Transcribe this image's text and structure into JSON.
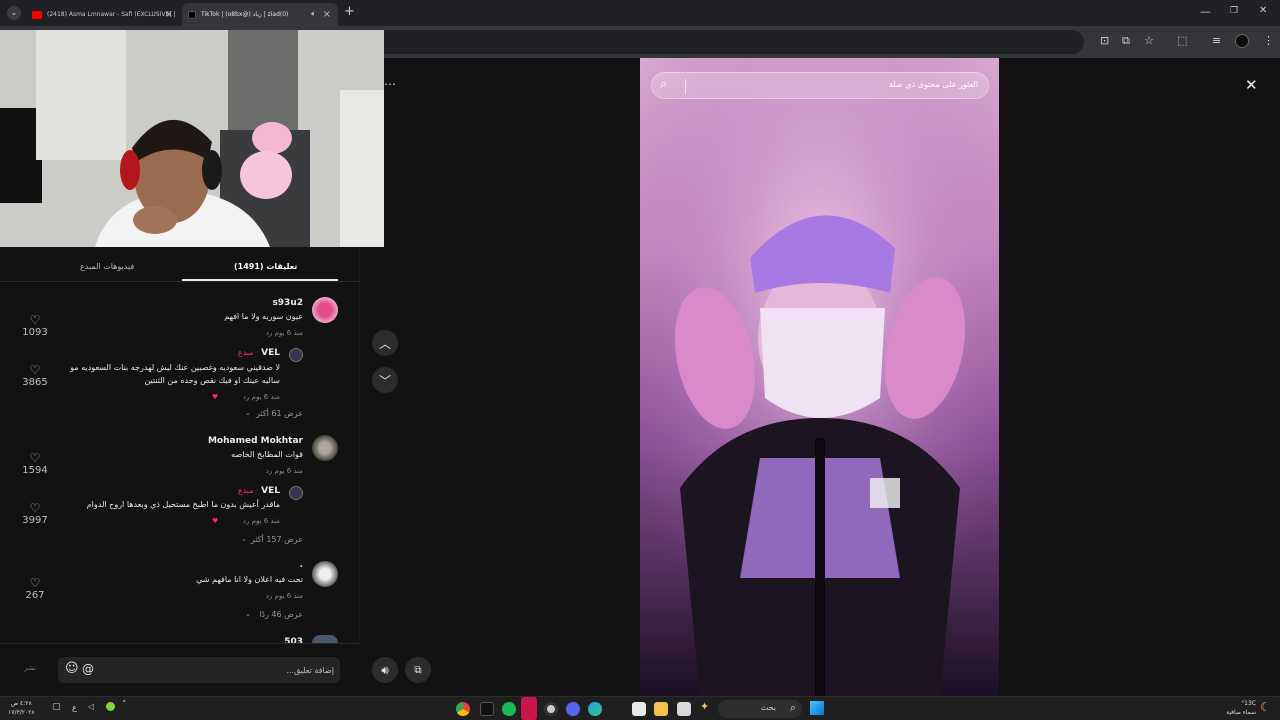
{
  "browser": {
    "tabs": [
      {
        "label": "(2418) Asma Lmnawar - Safi (EXCLUSIVE) |",
        "favicon": "youtube-icon"
      },
      {
        "label": "TikTok | (o8bx@) زياد | ziad(0)",
        "favicon": "tiktok-icon"
      }
    ],
    "new_tab": "+",
    "window_controls": [
      "—",
      "❐",
      "✕"
    ]
  },
  "comments_panel": {
    "tabs": {
      "creator_videos": "فيديوهات المبدع",
      "comments": "(1491) تعليقات"
    },
    "comments": [
      {
        "user": "s93u2",
        "text": "عيون سوريه ولا ما افهم",
        "meta": "منذ 6 يوم   رد",
        "likes": "1093",
        "reply": {
          "user": "VEL",
          "badge": "· مبدع",
          "text": "لا صدقيني سعوديه وغصبين عنك ليش لهدرجه بنات السعوديه مو ساليه عينك او فيك نقص وحده من الثنتين",
          "meta": "منذ 6 يوم   رد",
          "likes": "3865"
        },
        "more": "عرض 61 أكثر"
      },
      {
        "user": "Mohamed Mokhtar",
        "text": "قوات المطابخ الخاصه",
        "meta": "منذ 6 يوم   رد",
        "likes": "1594",
        "reply": {
          "user": "VEL",
          "badge": "· مبدع",
          "text": "ماقدر أعيش بدون ما اطبخ مستحيل ذي وبعدها اروح الدوام",
          "meta": "منذ 6 يوم   رد",
          "likes": "3997"
        },
        "more": "عرض 157 أكثر"
      },
      {
        "user": ".",
        "text": "تحت فيه اعلان ولا انا مافهم شي",
        "meta": "منذ 6 يوم   رد",
        "likes": "267",
        "more": "عرض 46 ردًا"
      },
      {
        "user": "503",
        "text": "",
        "meta": "",
        "likes": ""
      }
    ],
    "input_placeholder": "إضافة تعليق...",
    "post_label": "نشر",
    "emoji_icon": "☺",
    "mention_icon": "@"
  },
  "video": {
    "search_placeholder": "العثور على محتوى ذي صلة"
  },
  "taskbar": {
    "search_label": "بحث",
    "weather": "°13C",
    "weather_desc": "سماء صافية",
    "time": "٤:٢٨ ص",
    "date": "١٧/٣/٢٠٢٨",
    "lang": "ع"
  },
  "colors": {
    "creator_badge": "#fe2c55",
    "panel_bg": "#121212"
  }
}
